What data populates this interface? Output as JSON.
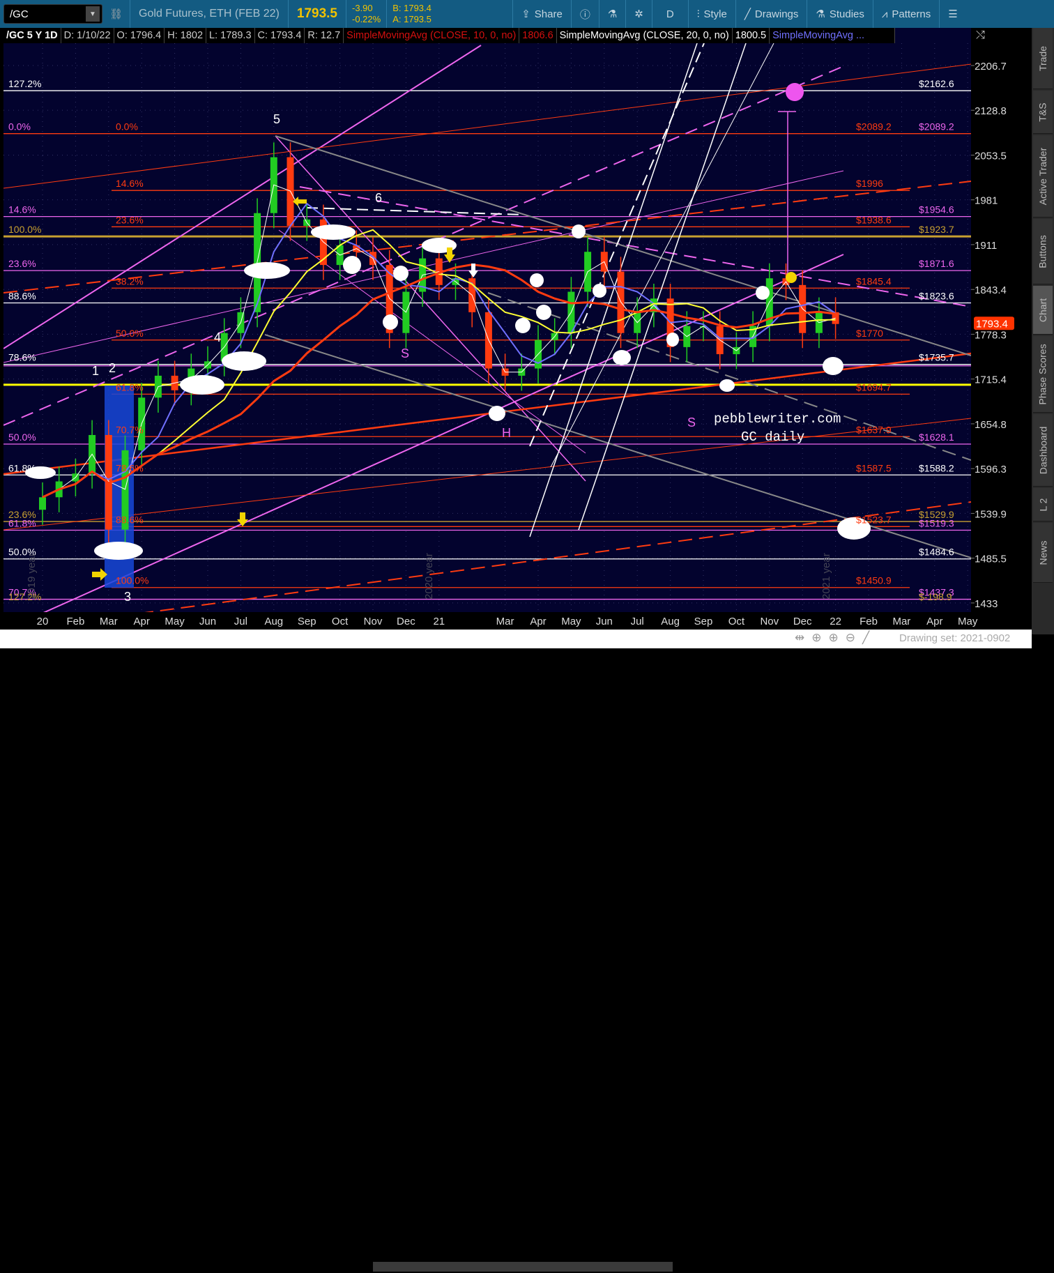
{
  "toolbar": {
    "symbol": "/GC",
    "description": "Gold Futures, ETH (FEB 22)",
    "last": "1793.5",
    "change": "-3.90",
    "change_pct": "-0.22%",
    "bid": "B: 1793.4",
    "ask": "A: 1793.5",
    "share": "Share",
    "aggregation": "D",
    "style": "Style",
    "drawings": "Drawings",
    "studies": "Studies",
    "patterns": "Patterns"
  },
  "legend": {
    "title": "/GC 5 Y 1D",
    "date": "D: 1/10/22",
    "open": "O: 1796.4",
    "high": "H: 1802",
    "low": "L: 1789.3",
    "close": "C: 1793.4",
    "range": "R: 12.7",
    "sma10": "SimpleMovingAvg (CLOSE, 10, 0, no)",
    "sma10_val": "1806.6",
    "sma20": "SimpleMovingAvg (CLOSE, 20, 0, no)",
    "sma20_val": "1800.5",
    "sma3": "SimpleMovingAvg ..."
  },
  "sidebar": {
    "tabs": [
      "Trade",
      "T&S",
      "Active Trader",
      "Buttons",
      "Chart",
      "Phase Scores",
      "Dashboard",
      "L 2",
      "News"
    ],
    "active": "Chart"
  },
  "footer": {
    "drawing_set": "Drawing set: 2021-0902"
  },
  "annotations": {
    "w1": "1",
    "w2": "2",
    "w3": "3",
    "w4": "4",
    "w5": "5",
    "w6": "6",
    "s1": "S",
    "h": "H",
    "s2": "S",
    "site": "pebblewriter.com",
    "subtitle": "GC daily",
    "y2019": "2019 year",
    "y2020": "2020 year",
    "y2021": "2021 year"
  },
  "colors": {
    "bg": "#03032e",
    "up": "#22cc22",
    "down": "#ff3b10",
    "pink": "#ee66ee",
    "red": "#ff3b10",
    "gold": "#c8a030",
    "yellow": "#ffff00",
    "white": "#ffffff"
  },
  "chart_data": {
    "type": "candlestick",
    "title": "/GC 5 Y 1D",
    "y_scale": "log",
    "ylim": [
      1433,
      2206.7
    ],
    "y_ticks": [
      "2206.7",
      "2128.8",
      "2053.5",
      "1981",
      "1911",
      "1843.4",
      "1778.3",
      "1715.4",
      "1654.8",
      "1596.3",
      "1539.9",
      "1485.5",
      "1433"
    ],
    "x_ticks": [
      "20",
      "Feb",
      "Mar",
      "Apr",
      "May",
      "Jun",
      "Jul",
      "Aug",
      "Sep",
      "Oct",
      "Nov",
      "Dec",
      "21",
      "Mar",
      "Apr",
      "May",
      "Jun",
      "Jul",
      "Aug",
      "Sep",
      "Oct",
      "Nov",
      "Dec",
      "22",
      "Feb",
      "Mar",
      "Apr",
      "May"
    ],
    "x_tick_months": [
      0,
      1,
      2,
      3,
      4,
      5,
      6,
      7,
      8,
      9,
      10,
      11,
      12,
      14,
      15,
      16,
      17,
      18,
      19,
      20,
      21,
      22,
      23,
      24,
      25,
      26,
      27,
      28
    ],
    "closes_biweekly_from_jan2020": [
      1560,
      1580,
      1590,
      1640,
      1520,
      1620,
      1690,
      1720,
      1700,
      1730,
      1740,
      1780,
      1810,
      1960,
      2050,
      1940,
      1950,
      1880,
      1910,
      1900,
      1880,
      1780,
      1840,
      1890,
      1850,
      1860,
      1810,
      1730,
      1720,
      1730,
      1770,
      1780,
      1840,
      1900,
      1870,
      1780,
      1810,
      1830,
      1760,
      1790,
      1790,
      1750,
      1760,
      1790,
      1860,
      1850,
      1780,
      1810,
      1793
    ],
    "last_price": "1793.4",
    "levels": [
      {
        "price": 2162.6,
        "color": "#ffffff",
        "left": "127.2%",
        "right": "$2162.6"
      },
      {
        "price": 2089.2,
        "color": "#ff3b10",
        "left": "0.0%",
        "left_color": "#ee66ee",
        "mid": "0.0%",
        "mid2": "$2089.2",
        "right": "$2089.2",
        "right_color": "#ee66ee"
      },
      {
        "price": 1996,
        "color": "#ff3b10",
        "mid": "14.6%",
        "mid2": "$1996",
        "short": true
      },
      {
        "price": 1954.6,
        "color": "#ee66ee",
        "left": "14.6%",
        "right": "$1954.6"
      },
      {
        "price": 1938.6,
        "color": "#ff3b10",
        "mid": "23.6%",
        "mid2": "$1938.6",
        "short": true
      },
      {
        "price": 1923.7,
        "color": "#c8a030",
        "left": "100.0%",
        "right": "$1923.7",
        "thick": true
      },
      {
        "price": 1871.6,
        "color": "#ee66ee",
        "left": "23.6%",
        "right": "$1871.6"
      },
      {
        "price": 1845.4,
        "color": "#ff3b10",
        "mid": "38.2%",
        "mid2": "$1845.4",
        "short": true
      },
      {
        "price": 1823.6,
        "color": "#ffffff",
        "left": "88.6%",
        "right": "$1823.6"
      },
      {
        "price": 1770,
        "color": "#ff3b10",
        "mid": "50.0%",
        "mid2": "$1770",
        "short": true
      },
      {
        "price": 1735.7,
        "color": "#ffffff",
        "left": "78.6%",
        "right": "$1735.7"
      },
      {
        "price": 1733.7,
        "color": "#ee66ee"
      },
      {
        "price": 1707.6,
        "color": "#ffff00",
        "thick": true
      },
      {
        "price": 1694.7,
        "color": "#ff3b10",
        "mid": "61.8%",
        "mid2": "$1694.7",
        "short": true
      },
      {
        "price": 1637.9,
        "color": "#ff3b10",
        "mid": "70.7%",
        "mid2": "$1637.9",
        "short": true
      },
      {
        "price": 1628.1,
        "color": "#ee66ee",
        "left": "50.0%",
        "right": "$1628.1"
      },
      {
        "price": 1588.2,
        "color": "#ffffff",
        "left": "61.8%",
        "mid": "78.6%",
        "mid2": "$1587.5",
        "right": "$1588.2"
      },
      {
        "price": 1529.9,
        "color": "#c8a030",
        "left": "23.6%",
        "right": "$1529.9"
      },
      {
        "price": 1523.7,
        "color": "#ff3b10",
        "mid": "88.6%",
        "mid2": "$1523.7",
        "short": true
      },
      {
        "price": 1519.3,
        "color": "#ee66ee",
        "left": "61.8%",
        "right": "$1519.3"
      },
      {
        "price": 1484.6,
        "color": "#ffffff",
        "left": "50.0%",
        "right": "$1484.6"
      },
      {
        "price": 1450.9,
        "color": "#ff3b10",
        "mid": "100.0%",
        "mid2": "$1450.9",
        "short": true
      },
      {
        "price": 1437.3,
        "color": "#ee66ee",
        "left": "70.7%",
        "right": "$1437.3"
      },
      {
        "price": 1432,
        "color": "#c8a030",
        "left": "127.2%",
        "right": "$-198.9",
        "noline": true
      }
    ]
  }
}
